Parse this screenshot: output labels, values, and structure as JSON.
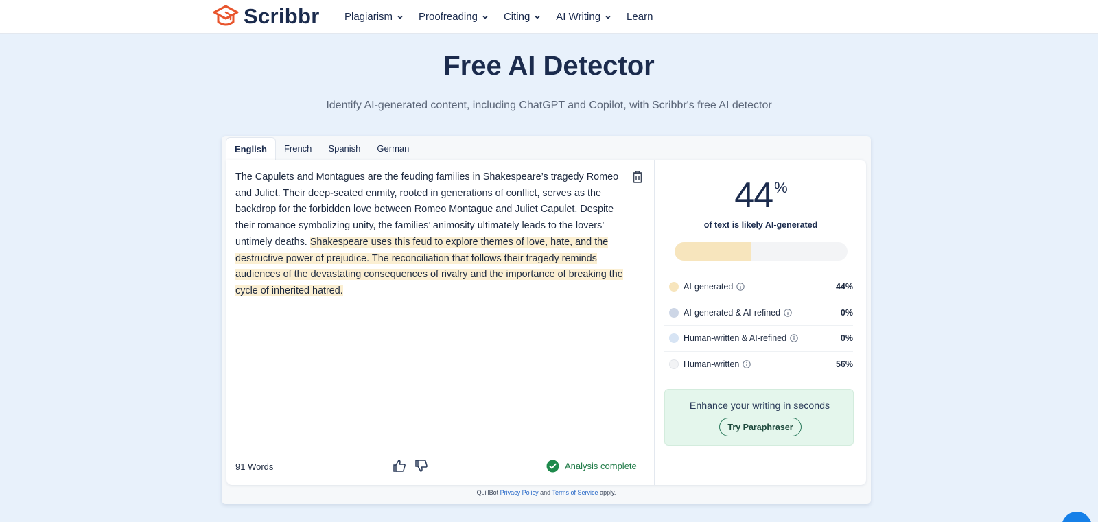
{
  "brand": {
    "name": "Scribbr",
    "accent": "#e8552d"
  },
  "nav": {
    "items": [
      {
        "label": "Plagiarism",
        "has_dropdown": true
      },
      {
        "label": "Proofreading",
        "has_dropdown": true
      },
      {
        "label": "Citing",
        "has_dropdown": true
      },
      {
        "label": "AI Writing",
        "has_dropdown": true
      },
      {
        "label": "Learn",
        "has_dropdown": false
      }
    ]
  },
  "hero": {
    "title": "Free AI Detector",
    "subtitle": "Identify AI-generated content, including ChatGPT and Copilot, with Scribbr's free AI detector"
  },
  "tool": {
    "tabs": [
      {
        "label": "English",
        "active": true
      },
      {
        "label": "French",
        "active": false
      },
      {
        "label": "Spanish",
        "active": false
      },
      {
        "label": "German",
        "active": false
      }
    ],
    "text_plain": "The Capulets and Montagues are the feuding families in Shakespeare’s tragedy Romeo and Juliet. Their deep-seated enmity, rooted in generations of conflict, serves as the backdrop for the forbidden love between Romeo Montague and Juliet Capulet. Despite their romance symbolizing unity, the families’ animosity ultimately leads to the lovers’ untimely deaths. ",
    "text_highlighted": "Shakespeare uses this feud to explore themes of love, hate, and the destructive power of prejudice. The reconciliation that follows their tragedy reminds audiences of the devastating consequences of rivalry and the importance of breaking the cycle of inherited hatred.",
    "word_count": "91 Words",
    "status": "Analysis complete"
  },
  "results": {
    "percent_value": "44",
    "percent_sign": "%",
    "ai_fraction": 0.44,
    "caption": "of text is likely AI-generated",
    "legend": [
      {
        "label": "AI-generated",
        "value": "44%",
        "color": "#f7e5bd"
      },
      {
        "label": "AI-generated & AI-refined",
        "value": "0%",
        "color": "#cdd6e6"
      },
      {
        "label": "Human-written & AI-refined",
        "value": "0%",
        "color": "#d7e4f4"
      },
      {
        "label": "Human-written",
        "value": "56%",
        "color": "#f2f3f5"
      }
    ],
    "promo_text": "Enhance your writing in seconds",
    "promo_button": "Try Paraphraser"
  },
  "footer": {
    "prefix": "QuillBot",
    "privacy": "Privacy Policy",
    "and": "and",
    "terms": "Terms of Service",
    "suffix": "apply."
  }
}
